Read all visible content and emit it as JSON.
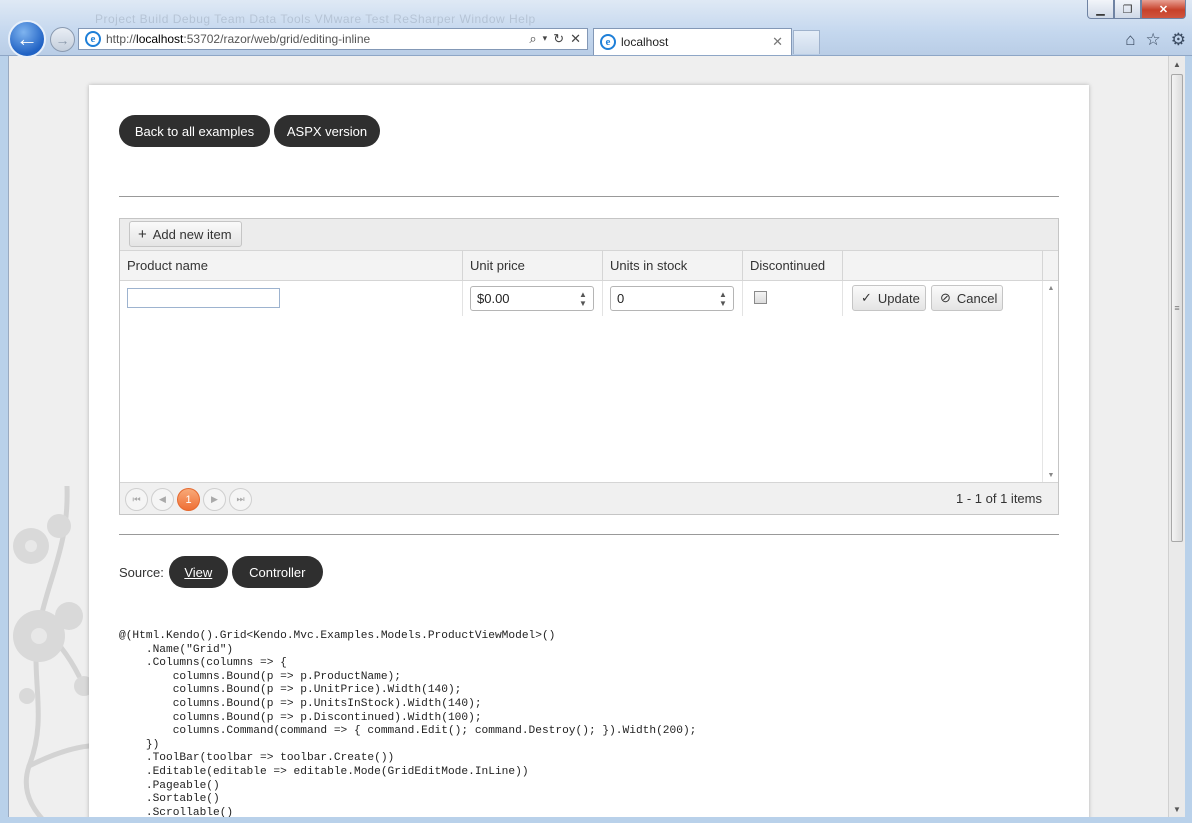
{
  "browser": {
    "menu_ghost": "Project  Build  Debug  Team  Data  Tools  VMware  Test  ReSharper  Window  Help",
    "url_prefix": "http://",
    "url_host": "localhost",
    "url_rest": ":53702/razor/web/grid/editing-inline",
    "tab_title": "localhost",
    "accent": "#2062c4"
  },
  "page": {
    "back_button": "Back to all examples",
    "aspx_button": "ASPX version"
  },
  "grid": {
    "add_button": "Add new item",
    "columns": [
      "Product name",
      "Unit price",
      "Units in stock",
      "Discontinued"
    ],
    "row": {
      "product_name": "",
      "unit_price": "$0.00",
      "units_in_stock": "0",
      "discontinued": false,
      "update_label": "Update",
      "cancel_label": "Cancel"
    },
    "pager": {
      "current_page": "1",
      "info": "1 - 1 of 1 items"
    },
    "active_color": "#ef6f35"
  },
  "source": {
    "label": "Source:",
    "view_button": "View",
    "controller_button": "Controller"
  },
  "code_lines": [
    "@(Html.Kendo().Grid<Kendo.Mvc.Examples.Models.ProductViewModel>()",
    "    .Name(\"Grid\")",
    "    .Columns(columns => {",
    "        columns.Bound(p => p.ProductName);",
    "        columns.Bound(p => p.UnitPrice).Width(140);",
    "        columns.Bound(p => p.UnitsInStock).Width(140);",
    "        columns.Bound(p => p.Discontinued).Width(100);",
    "        columns.Command(command => { command.Edit(); command.Destroy(); }).Width(200);",
    "    })",
    "    .ToolBar(toolbar => toolbar.Create())",
    "    .Editable(editable => editable.Mode(GridEditMode.InLine))",
    "    .Pageable()",
    "    .Sortable()",
    "    .Scrollable()"
  ]
}
